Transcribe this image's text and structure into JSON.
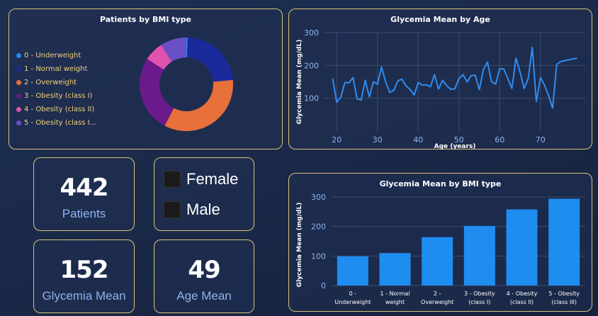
{
  "donut_card": {
    "title": "Patients by BMI type",
    "legend": [
      {
        "label": "0 - Underweight",
        "color": "#1f8cf0"
      },
      {
        "label": "1 - Normal weight",
        "color": "#1a2a9c"
      },
      {
        "label": "2 - Overweight",
        "color": "#e8703a"
      },
      {
        "label": "3 - Obesity (class I)",
        "color": "#6b1a8c"
      },
      {
        "label": "4 - Obesity (class II)",
        "color": "#e052b0"
      },
      {
        "label": "5 - Obesity (class I...",
        "color": "#6a4fc8"
      }
    ]
  },
  "age_card": {
    "title": "Glycemia Mean by Age"
  },
  "bmi_bar_card": {
    "title": "Glycemia Mean by BMI type"
  },
  "kpis": {
    "patients_value": "442",
    "patients_label": "Patients",
    "glycemia_value": "152",
    "glycemia_label": "Glycemia Mean",
    "age_value": "49",
    "age_label": "Age Mean"
  },
  "gender": {
    "female": "Female",
    "male": "Male"
  },
  "chart_data": [
    {
      "type": "pie",
      "title": "Patients by BMI type",
      "categories": [
        "0 - Underweight",
        "1 - Normal weight",
        "2 - Overweight",
        "3 - Obesity (class I)",
        "4 - Obesity (class II)",
        "5 - Obesity (class III)"
      ],
      "values": [
        2,
        102,
        151,
        117,
        30,
        40
      ],
      "colors": [
        "#1f8cf0",
        "#1a2a9c",
        "#e8703a",
        "#6b1a8c",
        "#e052b0",
        "#6a4fc8"
      ],
      "legend": "left"
    },
    {
      "type": "line",
      "title": "Glycemia Mean by Age",
      "xlabel": "Age (years)",
      "ylabel": "Glycemia Mean (mg/dL)",
      "xlim": [
        17,
        81
      ],
      "ylim": [
        0,
        300
      ],
      "xticks": [
        20,
        30,
        40,
        50,
        60,
        70
      ],
      "yticks": [
        100,
        200,
        300
      ],
      "color": "#2f8cf0",
      "x": [
        19,
        20,
        21,
        22,
        23,
        24,
        25,
        26,
        27,
        28,
        29,
        30,
        31,
        32,
        33,
        34,
        35,
        36,
        37,
        38,
        39,
        40,
        41,
        42,
        43,
        44,
        45,
        46,
        47,
        48,
        49,
        50,
        51,
        52,
        53,
        54,
        55,
        56,
        57,
        58,
        59,
        60,
        61,
        62,
        63,
        64,
        65,
        66,
        67,
        68,
        69,
        70,
        71,
        72,
        73,
        74,
        75,
        79
      ],
      "y": [
        160,
        88,
        103,
        148,
        147,
        163,
        98,
        95,
        155,
        104,
        150,
        143,
        195,
        150,
        118,
        124,
        153,
        158,
        138,
        127,
        110,
        148,
        140,
        141,
        135,
        172,
        128,
        155,
        138,
        127,
        129,
        160,
        172,
        150,
        169,
        170,
        126,
        188,
        210,
        150,
        143,
        190,
        189,
        160,
        130,
        222,
        180,
        130,
        160,
        255,
        90,
        163,
        140,
        108,
        70,
        203,
        212,
        222
      ],
      "grid": true
    },
    {
      "type": "bar",
      "title": "Glycemia Mean by BMI type",
      "xlabel": "",
      "ylabel": "Glycemia Mean (mg/dL)",
      "categories": [
        [
          "0 -",
          "Underweight"
        ],
        [
          "1 - Normal",
          "weight"
        ],
        [
          "2 -",
          "Overweight"
        ],
        [
          "3 - Obesity",
          "(class I)"
        ],
        [
          "4 - Obesity",
          "(class II)"
        ],
        [
          "5 - Obesity",
          "(class III)"
        ]
      ],
      "values": [
        99,
        110,
        164,
        202,
        258,
        294
      ],
      "ylim": [
        0,
        300
      ],
      "yticks": [
        0,
        100,
        200,
        300
      ],
      "color": "#1f8cf0",
      "grid": true
    }
  ]
}
